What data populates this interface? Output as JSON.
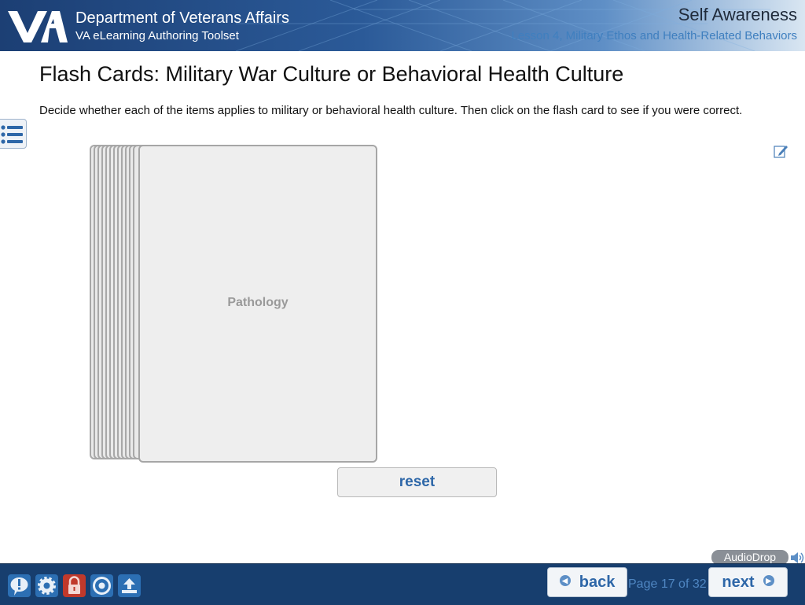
{
  "header": {
    "org_title": "Department of Veterans Affairs",
    "org_subtitle": "VA eLearning Authoring Toolset",
    "course_title": "Self Awareness",
    "lesson_title": "Lesson 4, Military Ethos and Health-Related Behaviors"
  },
  "page": {
    "heading": "Flash Cards: Military War Culture or Behavioral Health Culture",
    "instructions": "Decide whether each of the items applies to military or behavioral health culture.  Then click on the flash card to see if you were correct."
  },
  "flashcards": {
    "current_card_text": "Pathology",
    "reset_label": "reset"
  },
  "audio": {
    "label": "AudioDrop"
  },
  "footer": {
    "back_label": "back",
    "next_label": "next",
    "page_indicator": "Page 17 of 32",
    "tools": [
      "help-icon",
      "settings-icon",
      "lock-icon",
      "target-icon",
      "upload-icon"
    ]
  },
  "colors": {
    "header_dark": "#1c3f74",
    "footer_bg": "#173e6e",
    "accent_blue": "#2e67a8",
    "lock_red": "#c0392b"
  }
}
